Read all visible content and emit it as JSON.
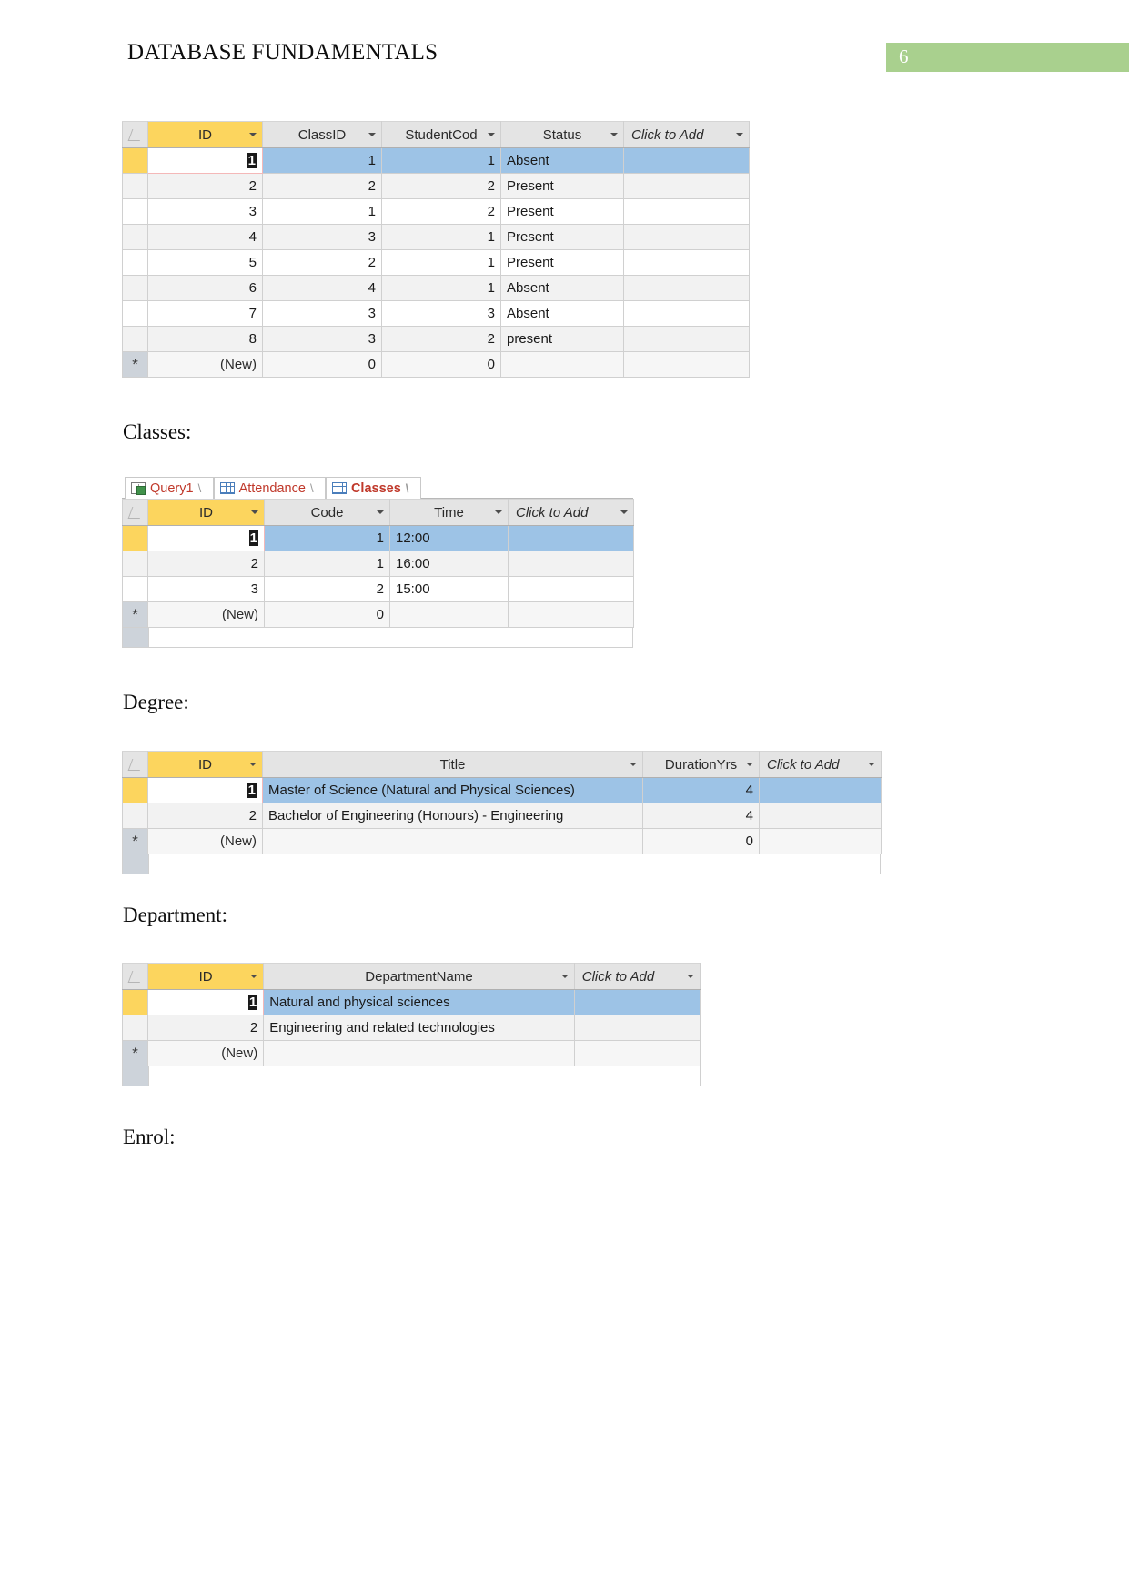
{
  "document": {
    "header_title": "DATABASE FUNDAMENTALS",
    "page_number": "6",
    "accent_green": "#a9d08e",
    "selected_row_blue": "#9dc3e6",
    "id_column_yellow": "#fcd55e"
  },
  "captions": {
    "classes": "Classes:",
    "degree": "Degree:",
    "department": "Department:",
    "enrol": "Enrol:"
  },
  "icons": {
    "table_icon": "table-icon",
    "query_icon": "query-icon",
    "dropdown_arrow": "chevron-down-icon",
    "select_all_corner": "select-all-icon",
    "new_record_asterisk": "*"
  },
  "attendance_table": {
    "name": "Attendance",
    "columns": [
      "ID",
      "ClassID",
      "StudentCod",
      "Status",
      "Click to Add"
    ],
    "rows": [
      {
        "id": "1",
        "classid": "1",
        "studentcod": "1",
        "status": "Absent",
        "selected": true
      },
      {
        "id": "2",
        "classid": "2",
        "studentcod": "2",
        "status": "Present",
        "selected": false
      },
      {
        "id": "3",
        "classid": "1",
        "studentcod": "2",
        "status": "Present",
        "selected": false
      },
      {
        "id": "4",
        "classid": "3",
        "studentcod": "1",
        "status": "Present",
        "selected": false
      },
      {
        "id": "5",
        "classid": "2",
        "studentcod": "1",
        "status": "Present",
        "selected": false
      },
      {
        "id": "6",
        "classid": "4",
        "studentcod": "1",
        "status": "Absent",
        "selected": false
      },
      {
        "id": "7",
        "classid": "3",
        "studentcod": "3",
        "status": "Absent",
        "selected": false
      },
      {
        "id": "8",
        "classid": "3",
        "studentcod": "2",
        "status": "present",
        "selected": false
      }
    ],
    "new_row": {
      "id": "(New)",
      "classid": "0",
      "studentcod": "0",
      "status": "",
      "marker": "*"
    }
  },
  "classes_table": {
    "name": "Classes",
    "tabs": [
      {
        "label": "Query1",
        "icon": "query-icon",
        "active": false
      },
      {
        "label": "Attendance",
        "icon": "table-icon",
        "active": false
      },
      {
        "label": "Classes",
        "icon": "table-icon",
        "active": true
      }
    ],
    "columns": [
      "ID",
      "Code",
      "Time",
      "Click to Add"
    ],
    "rows": [
      {
        "id": "1",
        "code": "1",
        "time": "12:00",
        "selected": true
      },
      {
        "id": "2",
        "code": "1",
        "time": "16:00",
        "selected": false
      },
      {
        "id": "3",
        "code": "2",
        "time": "15:00",
        "selected": false
      }
    ],
    "new_row": {
      "id": "(New)",
      "code": "0",
      "time": "",
      "marker": "*"
    }
  },
  "degree_table": {
    "name": "Degree",
    "columns": [
      "ID",
      "Title",
      "DurationYrs",
      "Click to Add"
    ],
    "rows": [
      {
        "id": "1",
        "title": "Master of Science (Natural and Physical Sciences)",
        "durationyrs": "4",
        "selected": true
      },
      {
        "id": "2",
        "title": "Bachelor of Engineering (Honours) - Engineering",
        "durationyrs": "4",
        "selected": false
      }
    ],
    "new_row": {
      "id": "(New)",
      "title": "",
      "durationyrs": "0",
      "marker": "*"
    }
  },
  "department_table": {
    "name": "Department",
    "columns": [
      "ID",
      "DepartmentName",
      "Click to Add"
    ],
    "rows": [
      {
        "id": "1",
        "departmentname": "Natural and physical sciences",
        "selected": true
      },
      {
        "id": "2",
        "departmentname": "Engineering and related technologies",
        "selected": false
      }
    ],
    "new_row": {
      "id": "(New)",
      "departmentname": "",
      "marker": "*"
    }
  }
}
